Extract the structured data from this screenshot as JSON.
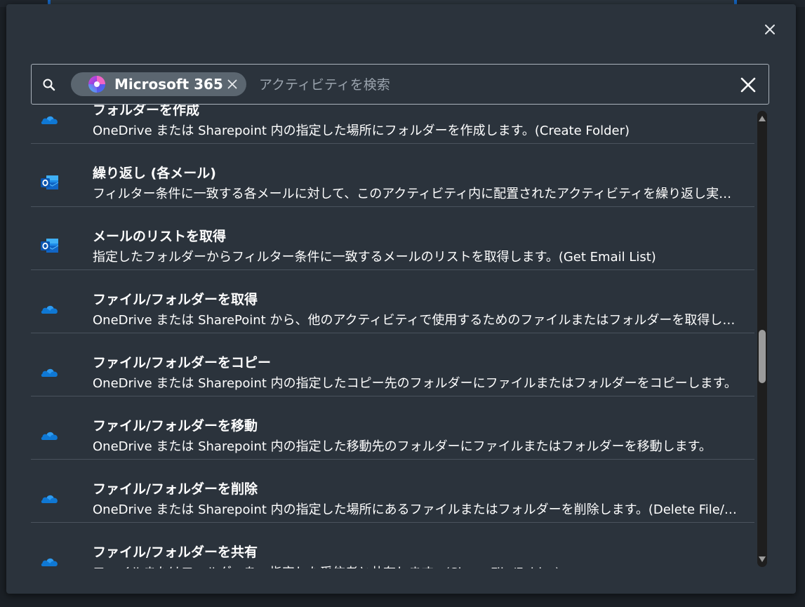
{
  "search": {
    "chip_label": "Microsoft 365",
    "placeholder": "アクティビティを検索",
    "value": ""
  },
  "icons": {
    "search": "search-icon",
    "close": "close-icon",
    "clear": "clear-icon",
    "chip_remove": "close-icon",
    "onedrive": "onedrive-cloud-icon",
    "outlook": "outlook-icon"
  },
  "colors": {
    "modal_bg": "#2b333c",
    "chip_bg": "#5b6670",
    "onedrive_blue": "#0f78d4",
    "outlook_blue": "#0a64c8",
    "divider": "#4a535d"
  },
  "items": [
    {
      "icon": "onedrive",
      "title": "フォルダーを作成",
      "description": "OneDrive または Sharepoint 内の指定した場所にフォルダーを作成します。(Create Folder)"
    },
    {
      "icon": "outlook",
      "title": "繰り返し (各メール)",
      "description": "フィルター条件に一致する各メールに対して、このアクティビティ内に配置されたアクティビティを繰り返し実行します。"
    },
    {
      "icon": "outlook",
      "title": "メールのリストを取得",
      "description": "指定したフォルダーからフィルター条件に一致するメールのリストを取得します。(Get Email List)"
    },
    {
      "icon": "onedrive",
      "title": "ファイル/フォルダーを取得",
      "description": "OneDrive または SharePoint から、他のアクティビティで使用するためのファイルまたはフォルダーを取得します。"
    },
    {
      "icon": "onedrive",
      "title": "ファイル/フォルダーをコピー",
      "description": "OneDrive または Sharepoint 内の指定したコピー先のフォルダーにファイルまたはフォルダーをコピーします。"
    },
    {
      "icon": "onedrive",
      "title": "ファイル/フォルダーを移動",
      "description": "OneDrive または Sharepoint 内の指定した移動先のフォルダーにファイルまたはフォルダーを移動します。"
    },
    {
      "icon": "onedrive",
      "title": "ファイル/フォルダーを削除",
      "description": "OneDrive または Sharepoint 内の指定した場所にあるファイルまたはフォルダーを削除します。(Delete File/Folder)"
    },
    {
      "icon": "onedrive",
      "title": "ファイル/フォルダーを共有",
      "description": "ファイルまたはフォルダーを、指定した受信者と共有します。(Share File/Folder)"
    }
  ]
}
